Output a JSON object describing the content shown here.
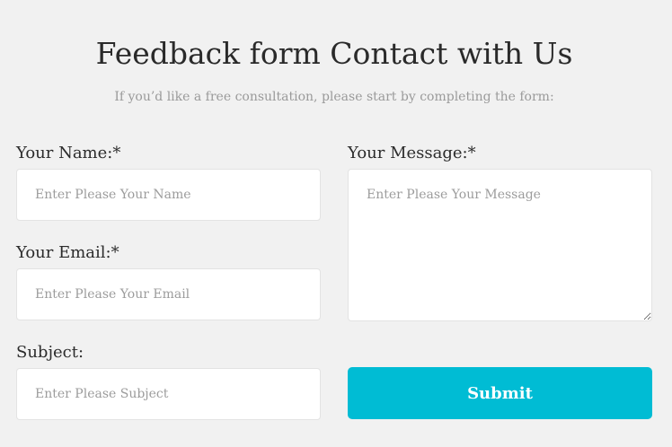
{
  "header": {
    "title": "Feedback form Contact with Us",
    "subtitle": "If you’d like a free consultation, please start by completing the form:"
  },
  "form": {
    "name": {
      "label": "Your Name:*",
      "placeholder": "Enter Please Your Name",
      "value": ""
    },
    "email": {
      "label": "Your Email:*",
      "placeholder": "Enter Please Your Email",
      "value": ""
    },
    "subject": {
      "label": "Subject:",
      "placeholder": "Enter Please Subject",
      "value": ""
    },
    "message": {
      "label": "Your Message:*",
      "placeholder": "Enter Please Your Message",
      "value": ""
    },
    "submit_label": "Submit"
  },
  "colors": {
    "background": "#f1f1f1",
    "accent": "#00bcd4",
    "field_background": "#ffffff",
    "placeholder": "#9c9c9c"
  }
}
